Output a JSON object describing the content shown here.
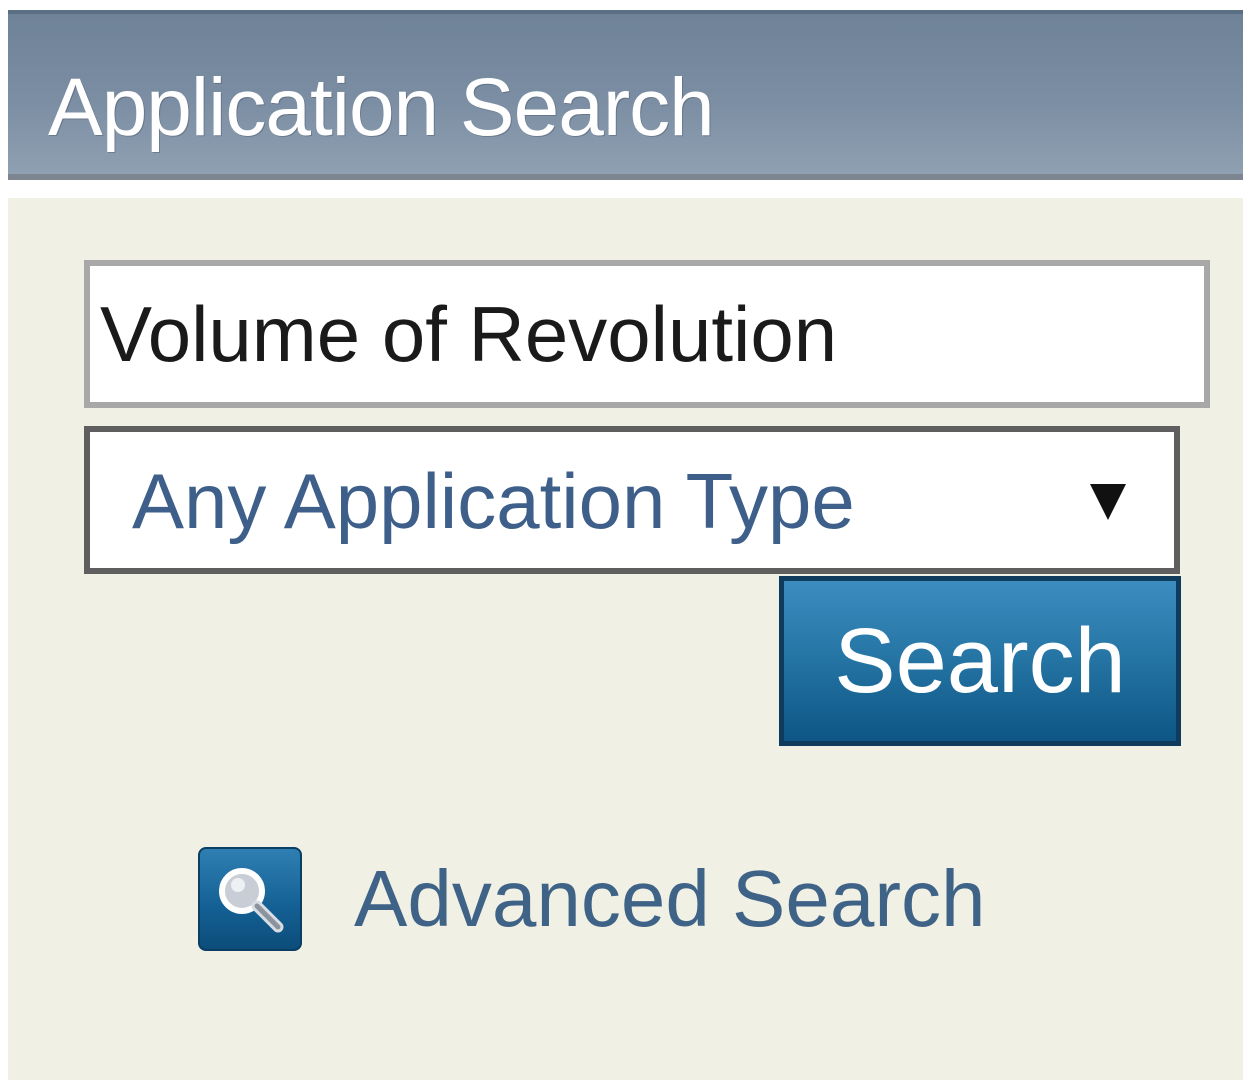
{
  "header": {
    "title": "Application Search"
  },
  "search": {
    "value": "Volume of Revolution"
  },
  "type_select": {
    "selected": "Any Application Type"
  },
  "search_button": {
    "label": "Search"
  },
  "advanced_search": {
    "label": "Advanced Search",
    "icon": "magnifier-icon"
  },
  "colors": {
    "header_bg": "#7c8ea3",
    "panel_bg": "#f0f0e4",
    "button_bg": "#2676a6",
    "link_text": "#3f6287"
  }
}
